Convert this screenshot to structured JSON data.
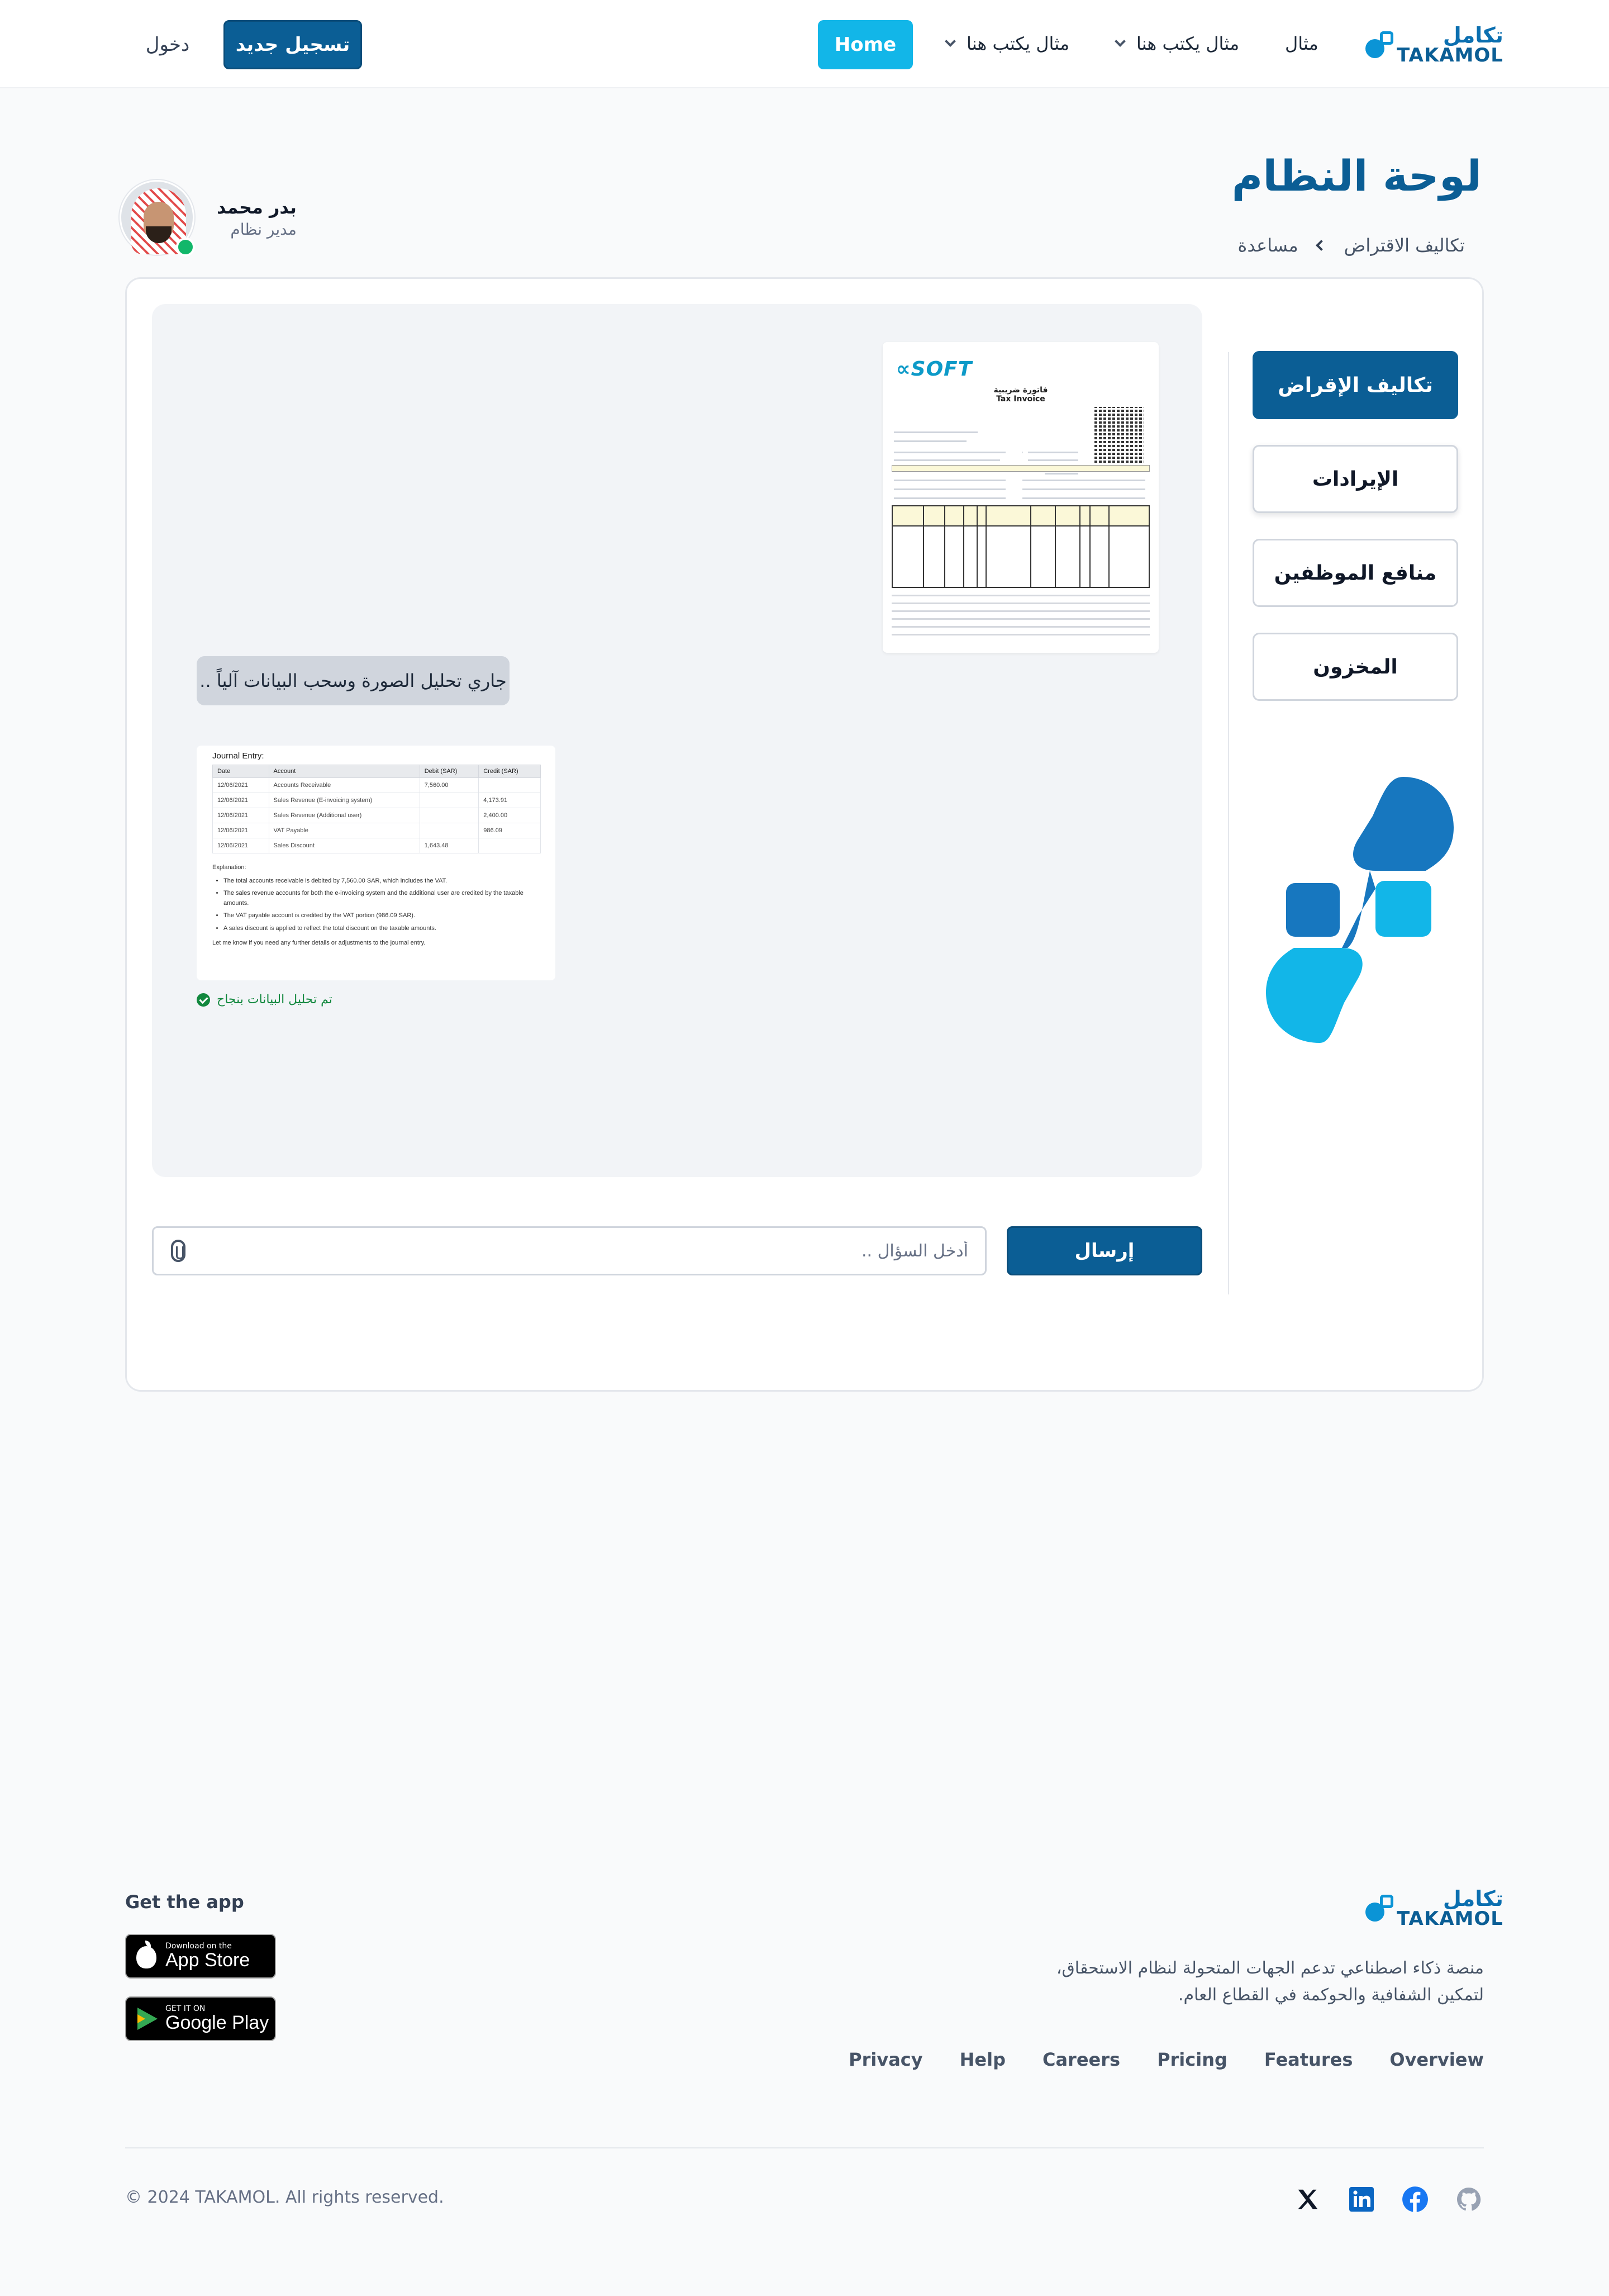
{
  "header": {
    "logo_ar": "تكامل",
    "logo_en": "TAKAMOL",
    "nav": {
      "item1": "مثال",
      "item2": "مثال يكتب هنا",
      "item3": "مثال يكتب هنا",
      "home": "Home"
    },
    "register": "تسجيل جديد",
    "login": "دخول"
  },
  "page": {
    "title": "لوحة النظام",
    "breadcrumb": [
      "تكاليف الاقتراض",
      "مساعدة"
    ]
  },
  "user": {
    "name": "بدر محمد",
    "role": "مدير نظام",
    "status": "online"
  },
  "sidebar": {
    "tabs": [
      {
        "label": "تكاليف الإقراض",
        "active": true
      },
      {
        "label": "الإيرادات",
        "active": false
      },
      {
        "label": "منافع الموظفين",
        "active": false
      },
      {
        "label": "المخزون",
        "active": false
      }
    ]
  },
  "chat": {
    "invoice": {
      "brand": "SOFT",
      "title_ar": "فاتورة ضريبية",
      "title_en": "Tax Invoice"
    },
    "bubble": "جاري تحليل الصورة وسحب البيانات آلياً ..",
    "journal": {
      "title": "Journal Entry:",
      "headers": [
        "Date",
        "Account",
        "Debit (SAR)",
        "Credit (SAR)"
      ],
      "rows": [
        [
          "12/06/2021",
          "Accounts Receivable",
          "7,560.00",
          ""
        ],
        [
          "12/06/2021",
          "Sales Revenue (E-invoicing system)",
          "",
          "4,173.91"
        ],
        [
          "12/06/2021",
          "Sales Revenue (Additional user)",
          "",
          "2,400.00"
        ],
        [
          "12/06/2021",
          "VAT Payable",
          "",
          "986.09"
        ],
        [
          "12/06/2021",
          "Sales Discount",
          "1,643.48",
          ""
        ]
      ],
      "explanation_title": "Explanation:",
      "points": [
        "The total accounts receivable is debited by 7,560.00 SAR, which includes the VAT.",
        "The sales revenue accounts for both the e-invoicing system and the additional user are credited by the taxable amounts.",
        "The VAT payable account is credited by the VAT portion (986.09 SAR).",
        "A sales discount is applied to reflect the total discount on the taxable amounts."
      ],
      "closing": "Let me know if you need any further details or adjustments to the journal entry."
    },
    "status": "تم تحليل البيانات بنجاح"
  },
  "input": {
    "placeholder": "أدخل السؤال ..",
    "value": "",
    "send": "إرسال"
  },
  "footer": {
    "get_app": "Get the app",
    "appstore_small": "Download on the",
    "appstore_big": "App Store",
    "play_small": "GET IT ON",
    "play_big": "Google Play",
    "description": "منصة ذكاء اصطناعي تدعم الجهات المتحولة لنظام الاستحقاق، لتمكين الشفافية والحوكمة في القطاع العام.",
    "links": [
      "Privacy",
      "Help",
      "Careers",
      "Pricing",
      "Features",
      "Overview"
    ],
    "copyright": "© 2024 TAKAMOL. All rights reserved.",
    "social": [
      "x-icon",
      "linkedin-icon",
      "facebook-icon",
      "github-icon"
    ]
  },
  "colors": {
    "primary": "#0b5e95",
    "accent": "#12b6e8",
    "success": "#12883e",
    "online": "#12b76a"
  }
}
